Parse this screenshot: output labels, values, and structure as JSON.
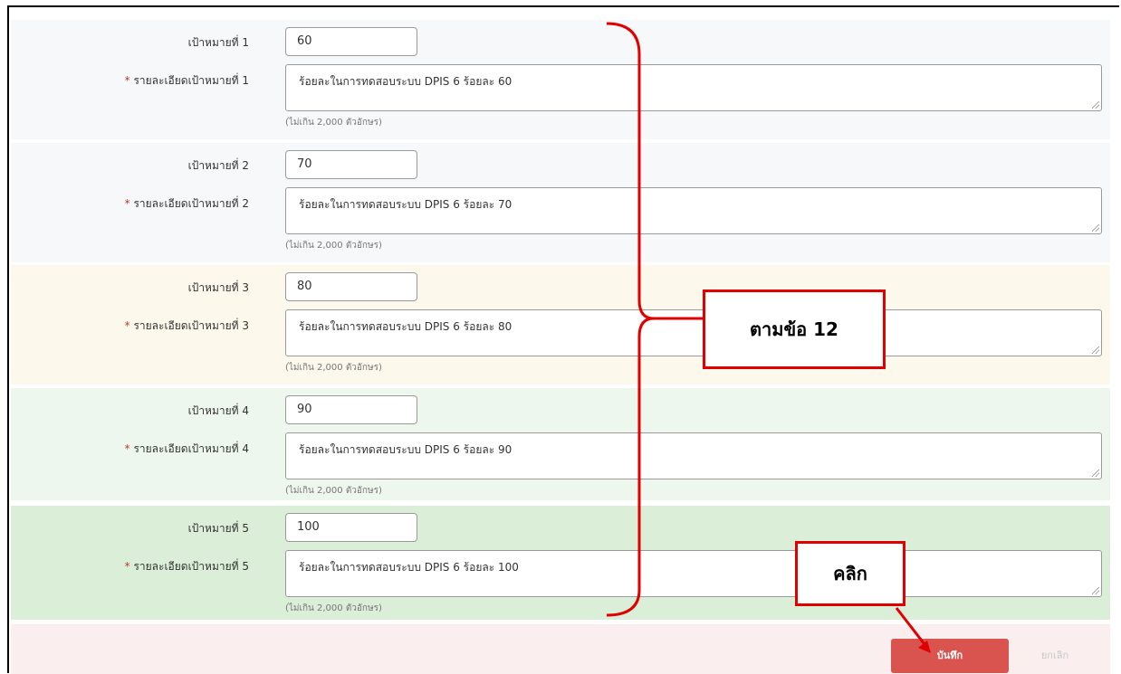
{
  "targets": [
    {
      "label": "เป้าหมายที่ 1",
      "detail_label": "รายละเอียดเป้าหมายที่ 1",
      "value": "60",
      "detail": "ร้อยละในการทดสอบระบบ DPIS 6 ร้อยละ 60",
      "hint": "(ไม่เกิน 2,000 ตัวอักษร)",
      "bg": "#f6f8fa"
    },
    {
      "label": "เป้าหมายที่ 2",
      "detail_label": "รายละเอียดเป้าหมายที่ 2",
      "value": "70",
      "detail": "ร้อยละในการทดสอบระบบ DPIS 6 ร้อยละ 70",
      "hint": "(ไม่เกิน 2,000 ตัวอักษร)",
      "bg": "#f6f8fa"
    },
    {
      "label": "เป้าหมายที่ 3",
      "detail_label": "รายละเอียดเป้าหมายที่ 3",
      "value": "80",
      "detail": "ร้อยละในการทดสอบระบบ DPIS 6 ร้อยละ 80",
      "hint": "(ไม่เกิน 2,000 ตัวอักษร)",
      "bg": "#fcf8ec"
    },
    {
      "label": "เป้าหมายที่ 4",
      "detail_label": "รายละเอียดเป้าหมายที่ 4",
      "value": "90",
      "detail": "ร้อยละในการทดสอบระบบ DPIS 6 ร้อยละ 90",
      "hint": "(ไม่เกิน 2,000 ตัวอักษร)",
      "bg": "#eef7ee"
    },
    {
      "label": "เป้าหมายที่ 5",
      "detail_label": "รายละเอียดเป้าหมายที่ 5",
      "value": "100",
      "detail": "ร้อยละในการทดสอบระบบ DPIS 6 ร้อยละ 100",
      "hint": "(ไม่เกิน 2,000 ตัวอักษร)",
      "bg": "#daeed8"
    }
  ],
  "required_mark": "*",
  "footer": {
    "save_label": "บันทึก",
    "cancel_label": "ยกเลิก"
  },
  "annotations": {
    "brace_note": "ตามข้อ 12",
    "click_note": "คลิก",
    "accent_color": "#e00000"
  }
}
